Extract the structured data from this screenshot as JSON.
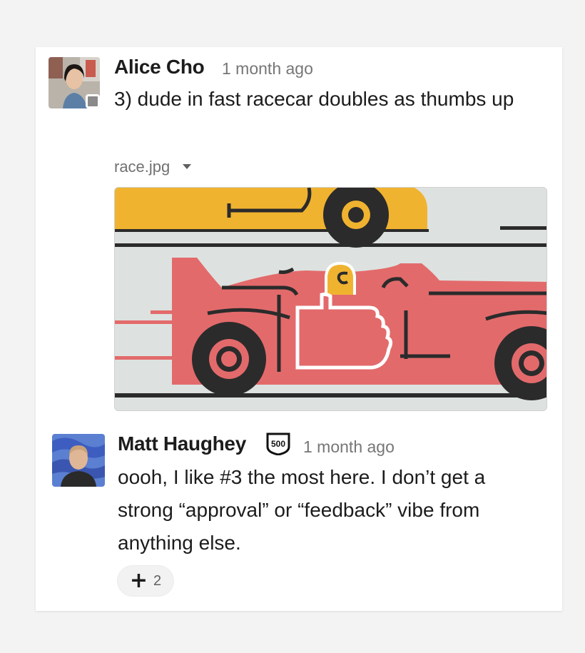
{
  "messages": [
    {
      "author": "Alice Cho",
      "timestamp": "1 month ago",
      "text": "3) dude in fast racecar doubles as thumbs up",
      "attachment": {
        "filename": "race.jpg",
        "image": "racecar-thumbs-up-illustration"
      },
      "presence": "away"
    },
    {
      "author": "Matt Haughey",
      "badge": "500",
      "timestamp": "1 month ago",
      "text": "oooh, I like #3 the most here. I don’t get a strong “approval” or “feedback” vibe from anything else.",
      "reaction": {
        "icon": "plus-icon",
        "label": "+",
        "count": "2"
      }
    }
  ],
  "colors": {
    "background": "#f3f3f3",
    "card": "#ffffff",
    "text": "#1d1c1d",
    "muted": "#767676",
    "car_red": "#e36a6b",
    "car_yellow": "#f0b330",
    "outline": "#2b2b2b",
    "image_bg": "#dde2e0"
  }
}
